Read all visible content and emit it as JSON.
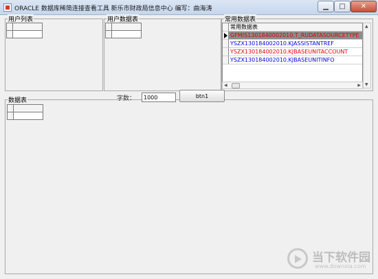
{
  "window": {
    "title": "ORACLE 数据库稀简连接查看工具 新乐市财政局信息中心  编写：曲海涛",
    "minimize_glyph": "▁",
    "maximize_glyph": "□",
    "close_glyph": "✕"
  },
  "panels": {
    "user_list": "用户列表",
    "user_tables": "用户数据表",
    "common_tables": "常用数据表",
    "data_table": "数据表"
  },
  "common_grid": {
    "header": "常用数据表",
    "rows": [
      {
        "text": "GFMIS130184000201​0.T_RUDATASOURCETYPE",
        "color": "#e00000",
        "selected": true
      },
      {
        "text": "YSZX130184002010.KJASSISTANTREF",
        "color": "#0000e0",
        "selected": false
      },
      {
        "text": "YSZX130184002010.KJBASEUNITACCOUNT",
        "color": "#e00000",
        "selected": false
      },
      {
        "text": "YSZX130184002010.KJBASEUNITINFO",
        "color": "#0000e0",
        "selected": false
      }
    ]
  },
  "controls": {
    "count_label": "字数：",
    "count_value": "1000",
    "button_label": "btn1"
  },
  "watermark": {
    "name": "当下软件园",
    "domain": "www.downxia.com"
  },
  "colors": {
    "selected_row_bg": "#8c8c8c",
    "red_text": "#e00000",
    "blue_text": "#0000e0"
  }
}
